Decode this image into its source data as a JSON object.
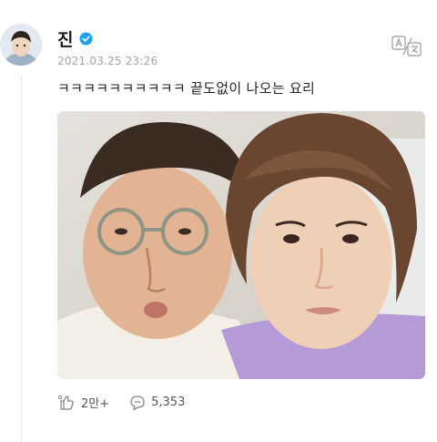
{
  "post": {
    "author": "진",
    "timestamp": "2021.03.25 23:26",
    "text": "ㅋㅋㅋㅋㅋㅋㅋㅋㅋㅋ 끝도없이 나오는 요리",
    "verified_icon": "verified-badge-icon",
    "translate_icon": "translate-icon"
  },
  "actions": {
    "like_count": "2만+",
    "comment_count": "5,353",
    "like_icon": "like-icon",
    "comment_icon": "comment-icon"
  },
  "colors": {
    "verified": "#1da1f2",
    "meta_text": "#a4a4a4",
    "thread_line": "#e6e6e6"
  }
}
